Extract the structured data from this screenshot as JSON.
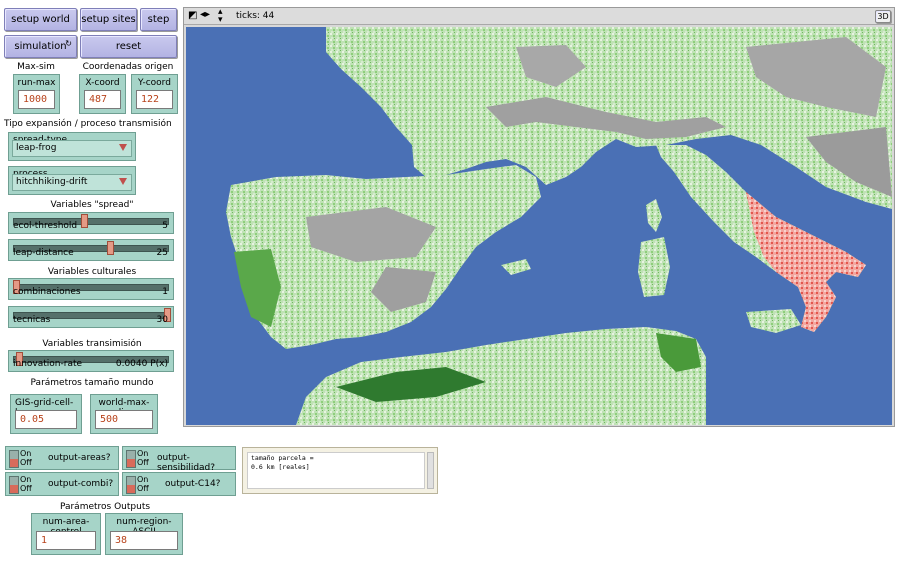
{
  "buttons": {
    "setup_world": "setup world",
    "setup_sites": "setup sites",
    "step": "step",
    "simulation": "simulation",
    "reset": "reset"
  },
  "labels": {
    "max_sim": "Max-sim",
    "coord_origen": "Coordenadas origen",
    "tipo_expansion": "Tipo expansión / proceso transmisión",
    "variables_spread": "Variables \"spread\"",
    "variables_culturales": "Variables culturales",
    "variables_transmision": "Variables transimisión",
    "parametros_mundo": "Parámetros tamaño mundo",
    "parametros_outputs": "Parámetros Outputs"
  },
  "monitors": {
    "run_max": {
      "name": "run-max",
      "value": "1000"
    },
    "x_coord": {
      "name": "X-coord",
      "value": "487"
    },
    "y_coord": {
      "name": "Y-coord",
      "value": "122"
    },
    "gis_grid": {
      "name": "GIS-grid-cell-km",
      "value": "0.05"
    },
    "world_max": {
      "name": "world-max-dim",
      "value": "500"
    },
    "num_area": {
      "name": "num-area-control",
      "value": "1"
    },
    "num_region": {
      "name": "num-region-ASCII",
      "value": "38"
    }
  },
  "choosers": {
    "spread_type": {
      "name": "spread-type",
      "value": "leap-frog"
    },
    "process": {
      "name": "process",
      "value": "hitchhiking-drift"
    }
  },
  "sliders": {
    "ecol_threshold": {
      "name": "ecol-threshold",
      "value": "5",
      "fraction": 0.45
    },
    "leap_distance": {
      "name": "leap-distance",
      "value": "25",
      "fraction": 0.62
    },
    "combinaciones": {
      "name": "combinaciones",
      "value": "1",
      "fraction": 0.0
    },
    "tecnicas": {
      "name": "tecnicas",
      "value": "30",
      "fraction": 1.0
    },
    "innovation_rate": {
      "name": "innovation-rate",
      "value": "0.0040 P(x)",
      "fraction": 0.02
    }
  },
  "switches": {
    "on_label": "On",
    "off_label": "Off",
    "output_areas": "output-areas?",
    "output_sensibilidad": "output-sensibilidad?",
    "output_combi": "output-combi?",
    "output_c14": "output-C14?"
  },
  "world": {
    "ticks_label": "ticks: 44",
    "btn_3d": "3D"
  },
  "note": {
    "line1": "tamaño parcela =",
    "line2": "0.6 km [reales]"
  },
  "colors": {
    "sea": "#4a70b5",
    "land_light": "#cfe8c6",
    "land_mid": "#7cc46a",
    "land_dark": "#2f7a2f",
    "mountain": "#9b9b9b",
    "spread": "#e6605a"
  }
}
